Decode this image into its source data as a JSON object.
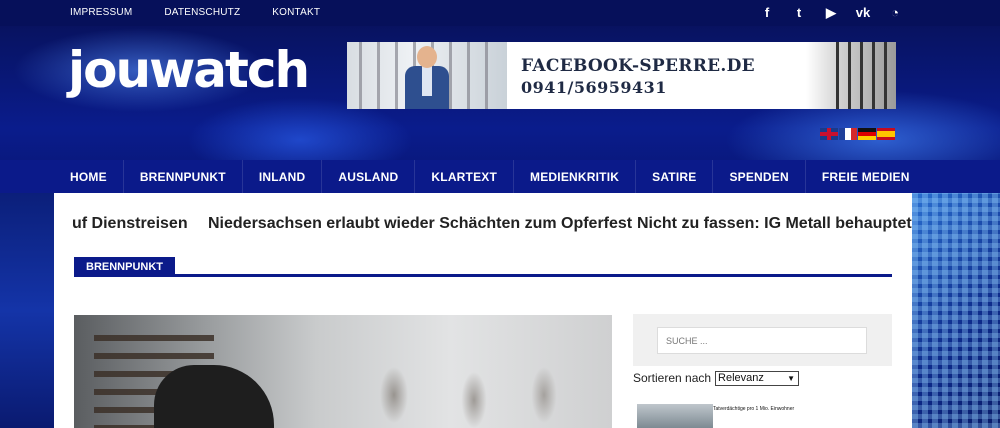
{
  "topbar": {
    "links": [
      "IMPRESSUM",
      "DATENSCHUTZ",
      "KONTAKT"
    ],
    "social_icons": [
      "facebook-icon",
      "twitter-icon",
      "youtube-icon",
      "vk-icon",
      "rss-icon"
    ],
    "social_glyphs": [
      "f",
      "t",
      "▶",
      "vk",
      "◔"
    ]
  },
  "logo": {
    "text": "jouwatch"
  },
  "banner": {
    "line1": "FACEBOOK-SPERRE.DE",
    "line2": "0941/56959431"
  },
  "flags": [
    "uk-flag",
    "fr-flag",
    "de-flag",
    "es-flag"
  ],
  "nav": {
    "items": [
      "HOME",
      "BRENNPUNKT",
      "INLAND",
      "AUSLAND",
      "KLARTEXT",
      "MEDIENKRITIK",
      "SATIRE",
      "SPENDEN",
      "FREIE MEDIEN"
    ]
  },
  "ticker": {
    "items": [
      "uf Dienstreisen",
      "Niedersachsen erlaubt wieder Schächten zum Opferfest",
      "Nicht zu fassen: IG Metall behauptet"
    ]
  },
  "section": {
    "tag": "BRENNPUNKT"
  },
  "sidebar": {
    "search_placeholder": "SUCHE ...",
    "sort_label": "Sortieren nach",
    "sort_value": "Relevanz",
    "thumb_caption": "Tatverdächtige pro 1 Mio. Einwohner"
  },
  "colors": {
    "nav_bg": "#0b1a8a",
    "topbar_bg": "#06105a",
    "accent": "#0b1a8a"
  }
}
